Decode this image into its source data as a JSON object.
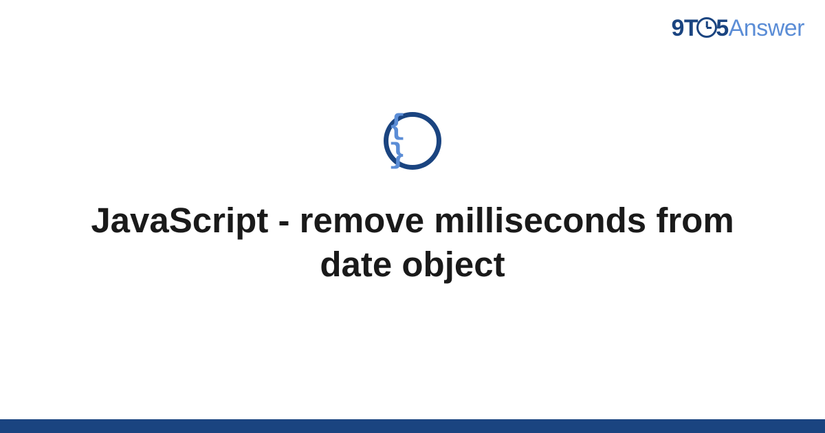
{
  "brand": {
    "part1": "9T",
    "part2": "5",
    "part3": "Answer"
  },
  "icon": {
    "braces": "{ }"
  },
  "title": "JavaScript - remove milliseconds from date object",
  "colors": {
    "primary": "#1a4480",
    "accent": "#5b8dd6"
  }
}
